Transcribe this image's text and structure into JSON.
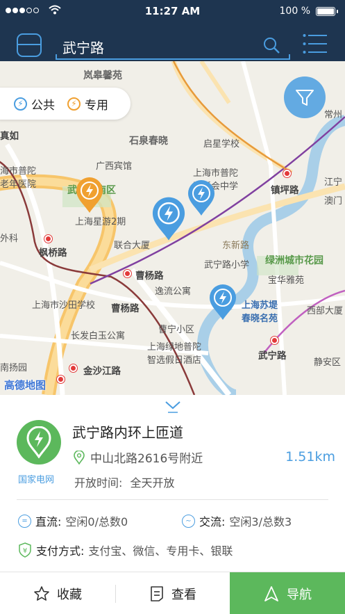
{
  "status": {
    "time": "11:27 AM",
    "battery": "100 %"
  },
  "search": {
    "query": "武宁路"
  },
  "legend": {
    "public": "公共",
    "private": "专用"
  },
  "map": {
    "labels": {
      "lanfuyuan": "岚皋馨苑",
      "shiquan": "石泉春晓",
      "qixing": "启星学校",
      "guangxi": "广西宾馆",
      "putuo_school": "上海市普陀\n区新会中学",
      "putuo_hospital": "海市普陀\n老年医院",
      "wuning_park": "武宁园南区",
      "xingyu": "上海星游2期",
      "fengqiao": "枫桥路",
      "lianhe": "联合大厦",
      "caoyang_rd": "曹杨路",
      "dongxin": "东新路",
      "wuning_school": "武宁路小学",
      "lvzhou": "绿洲城市花园",
      "baohuaya": "宝华雅苑",
      "zhenping": "镇坪路",
      "aomen": "澳门",
      "jiangning": "江宁",
      "yuanyi": "逸流公寓",
      "shadian": "上海市沙田学校",
      "caoyang_rd2": "曹杨路",
      "caoning": "曹宁小区",
      "suti": "上海苏堤\n春晓名苑",
      "xibu": "西部大厦",
      "changfa": "长发白玉公寓",
      "lvdi": "上海绿地普陀\n智选假日酒店",
      "wuning_rd": "武宁路",
      "jingan": "静安区",
      "jinshajiang": "金沙江路",
      "nanyang": "南扬园",
      "waike": "外科",
      "zhenru": "真如",
      "changzhou": "常州",
      "amap": "高德地图"
    }
  },
  "station": {
    "name": "武宁路内环上匝道",
    "brand": "国家电网",
    "address": "中山北路2616号附近",
    "distance": "1.51km",
    "hours_label": "开放时间:",
    "hours_value": "全天开放",
    "dc_label": "直流:",
    "dc_value": "空闲0/总数0",
    "ac_label": "交流:",
    "ac_value": "空闲3/总数3",
    "pay_label": "支付方式:",
    "pay_value": "支付宝、微信、专用卡、银联"
  },
  "bar": {
    "favorite": "收藏",
    "view": "查看",
    "navigate": "导航"
  },
  "colors": {
    "navy": "#1e3550",
    "accent": "#4a9de0",
    "green": "#5cb85c",
    "orange": "#f0a030"
  }
}
